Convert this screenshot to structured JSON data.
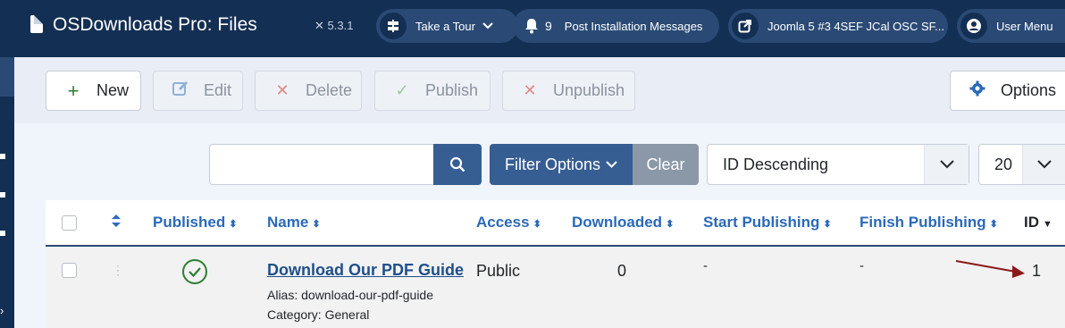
{
  "header": {
    "title": "OSDownloads Pro: Files",
    "version": "5.3.1",
    "tour_label": "Take a Tour",
    "messages_count": "9",
    "messages_label": "Post Installation Messages",
    "site_label": "Joomla 5 #3 4SEF JCal OSC SF...",
    "user_menu_label": "User Menu"
  },
  "toolbar": {
    "new_label": "New",
    "edit_label": "Edit",
    "delete_label": "Delete",
    "publish_label": "Publish",
    "unpublish_label": "Unpublish",
    "options_label": "Options"
  },
  "filters": {
    "search_value": "",
    "filter_options_label": "Filter Options",
    "clear_label": "Clear",
    "ordering_value": "ID Descending",
    "limit_value": "20"
  },
  "table": {
    "columns": [
      "Published",
      "Name",
      "Access",
      "Downloaded",
      "Start Publishing",
      "Finish Publishing",
      "ID"
    ],
    "rows": [
      {
        "name": "Download Our PDF Guide",
        "alias": "Alias: download-our-pdf-guide",
        "category": "Category: General",
        "access": "Public",
        "downloaded": "0",
        "start_publishing": "-",
        "finish_publishing": "-",
        "id": "1"
      }
    ]
  },
  "colors": {
    "header_bg": "#132f53",
    "primary": "#365e92",
    "link": "#2a69b8",
    "published_green": "#2f7d32",
    "annotation_arrow": "#8b1a1a"
  },
  "icons": [
    "file-icon",
    "joomla-icon",
    "signpost-icon",
    "bell-icon",
    "external-link-icon",
    "user-icon",
    "plus-icon",
    "edit-icon",
    "times-icon",
    "check-icon",
    "gear-icon",
    "search-icon",
    "chevron-down-icon",
    "sort-icon",
    "drag-handle-icon",
    "check-circle-icon",
    "arrow-annotation"
  ]
}
